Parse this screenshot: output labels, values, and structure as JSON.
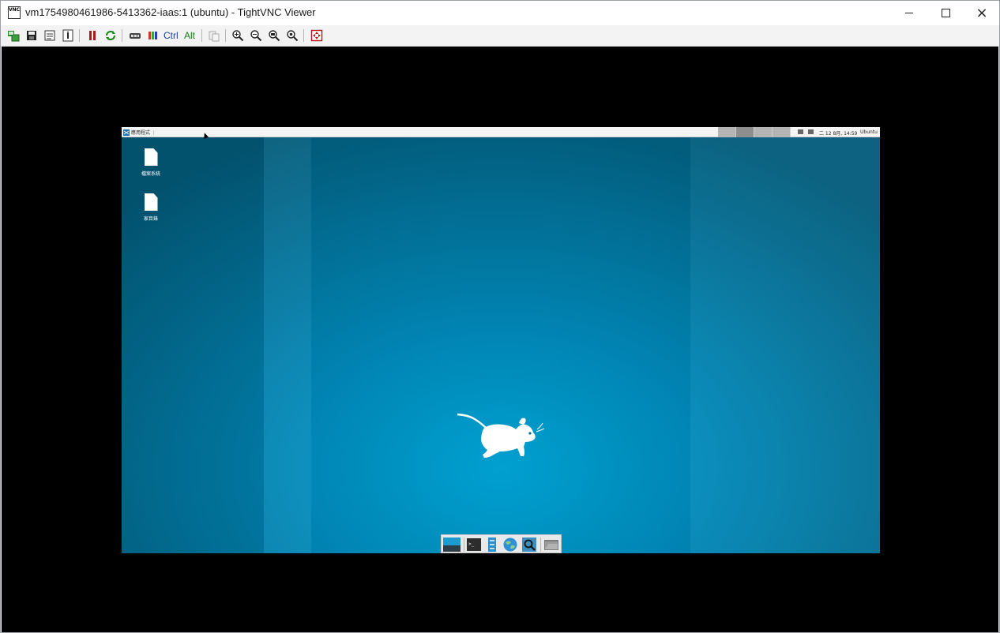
{
  "window": {
    "title": "vm1754980461986-5413362-iaas:1 (ubuntu) - TightVNC Viewer",
    "app_icon_text": [
      "VNC"
    ],
    "controls": {
      "minimize": "minimize",
      "maximize": "maximize",
      "close": "×"
    }
  },
  "toolbar": {
    "ctrl_label": "Ctrl",
    "alt_label": "Alt",
    "icons": [
      "new-connection-icon",
      "save-icon",
      "options-icon",
      "info-icon",
      "pause-icon",
      "refresh-icon",
      "ctrl-alt-del-icon",
      "ctrl-esc-icon",
      "clipboard-icon",
      "zoom-in-icon",
      "zoom-out-icon",
      "zoom-100-icon",
      "zoom-fit-icon",
      "fullscreen-icon"
    ]
  },
  "remote_desktop": {
    "panel": {
      "app_menu_label": "應用程式 ⋮",
      "workspaces": 4,
      "active_workspace": 2,
      "clock": "二 12 8月, 14:59",
      "user": "Ubuntu"
    },
    "desktop_icons": [
      {
        "label": "檔案系統",
        "icon": "file-icon"
      },
      {
        "label": "家目錄",
        "icon": "file-icon"
      }
    ],
    "dock_items": [
      "show-desktop-icon",
      "terminal-icon",
      "file-manager-icon",
      "web-browser-icon",
      "app-finder-icon",
      "folder-icon"
    ],
    "colors": {
      "background_center": "#00a6d8",
      "background_edge": "#035c7b",
      "panel": "#f4f4f4"
    }
  }
}
